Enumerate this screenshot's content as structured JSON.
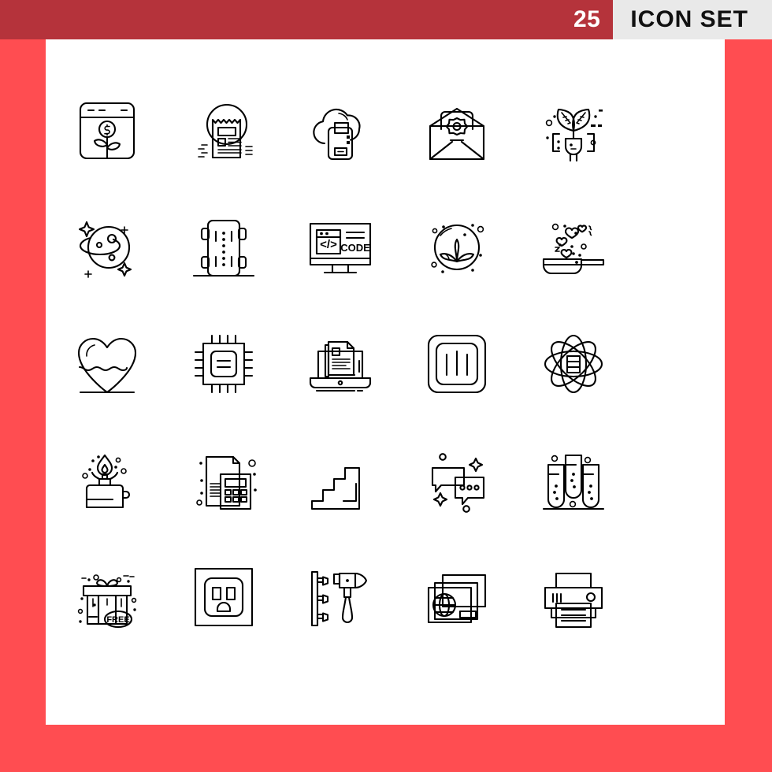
{
  "header": {
    "count": "25",
    "title": "ICON SET",
    "badge_color": "#B5333B",
    "title_bg_color": "#E9E9E9",
    "page_bg_color": "#FF4D51",
    "card_bg_color": "#FFFFFF",
    "stroke_color": "#000000"
  },
  "grid": {
    "columns": 5,
    "rows": 5,
    "total": 25
  },
  "icons": [
    {
      "index": 1,
      "name": "browser-money-plant-icon",
      "label": "Money Plant Browser"
    },
    {
      "index": 2,
      "name": "news-receipt-icon",
      "label": "News Receipt"
    },
    {
      "index": 3,
      "name": "cloud-backup-icon",
      "label": "Cloud Backup"
    },
    {
      "index": 4,
      "name": "award-envelope-icon",
      "label": "Award Mail"
    },
    {
      "index": 5,
      "name": "eco-plug-icon",
      "label": "Green Energy Plug"
    },
    {
      "index": 6,
      "name": "planet-saturn-icon",
      "label": "Planet"
    },
    {
      "index": 7,
      "name": "road-vehicle-top-icon",
      "label": "Road Vehicle"
    },
    {
      "index": 8,
      "name": "code-monitor-icon",
      "label": "Code Monitor",
      "text": "CODE",
      "symbol": "</>"
    },
    {
      "index": 9,
      "name": "lotus-spa-icon",
      "label": "Lotus Spa"
    },
    {
      "index": 10,
      "name": "frying-pan-hearts-icon",
      "label": "Cooking Love"
    },
    {
      "index": 11,
      "name": "heart-liquid-icon",
      "label": "Heart Liquid"
    },
    {
      "index": 12,
      "name": "cpu-processor-icon",
      "label": "Processor"
    },
    {
      "index": 13,
      "name": "laptop-documents-icon",
      "label": "Laptop Documents"
    },
    {
      "index": 14,
      "name": "light-switch-panel-icon",
      "label": "Light Switch"
    },
    {
      "index": 15,
      "name": "atom-database-icon",
      "label": "Atom Database"
    },
    {
      "index": 16,
      "name": "camping-stove-icon",
      "label": "Camping Stove"
    },
    {
      "index": 17,
      "name": "calculator-document-icon",
      "label": "Accounting"
    },
    {
      "index": 18,
      "name": "stairs-icon",
      "label": "Stairs"
    },
    {
      "index": 19,
      "name": "chat-bubbles-icon",
      "label": "Chat"
    },
    {
      "index": 20,
      "name": "test-tubes-icon",
      "label": "Test Tubes"
    },
    {
      "index": 21,
      "name": "free-gift-box-icon",
      "label": "Free Gift",
      "text": "FREE"
    },
    {
      "index": 22,
      "name": "power-outlet-icon",
      "label": "Power Outlet"
    },
    {
      "index": 23,
      "name": "hammer-nails-icon",
      "label": "Hammer and Nails"
    },
    {
      "index": 24,
      "name": "global-documents-icon",
      "label": "Global Documents"
    },
    {
      "index": 25,
      "name": "printer-icon",
      "label": "Printer"
    }
  ]
}
